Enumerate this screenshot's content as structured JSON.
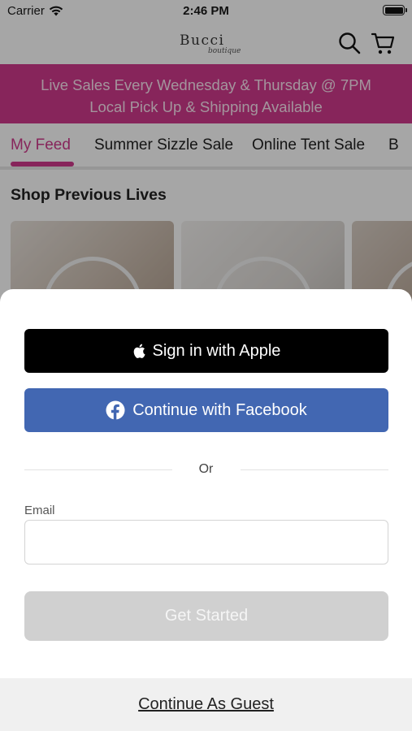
{
  "status_bar": {
    "carrier": "Carrier",
    "time": "2:46 PM"
  },
  "header": {
    "logo_text": "Bucci",
    "logo_subtext": "boutique",
    "icons": [
      "search-icon",
      "cart-icon"
    ]
  },
  "banner": {
    "line1": "Live Sales Every Wednesday & Thursday @ 7PM",
    "line2": "Local Pick Up & Shipping Available",
    "color": "#cf3a8c"
  },
  "tabs": [
    {
      "label": "My Feed",
      "active": true
    },
    {
      "label": "Summer Sizzle Sale",
      "active": false
    },
    {
      "label": "Online Tent Sale",
      "active": false
    },
    {
      "label": "B",
      "active": false
    }
  ],
  "section": {
    "title": "Shop Previous Lives"
  },
  "login_sheet": {
    "apple_label": "Sign in with Apple",
    "facebook_label": "Continue with Facebook",
    "divider_text": "Or",
    "email_label": "Email",
    "email_value": "",
    "get_started_label": "Get Started",
    "guest_label": "Continue As Guest",
    "facebook_color": "#4267b2"
  }
}
